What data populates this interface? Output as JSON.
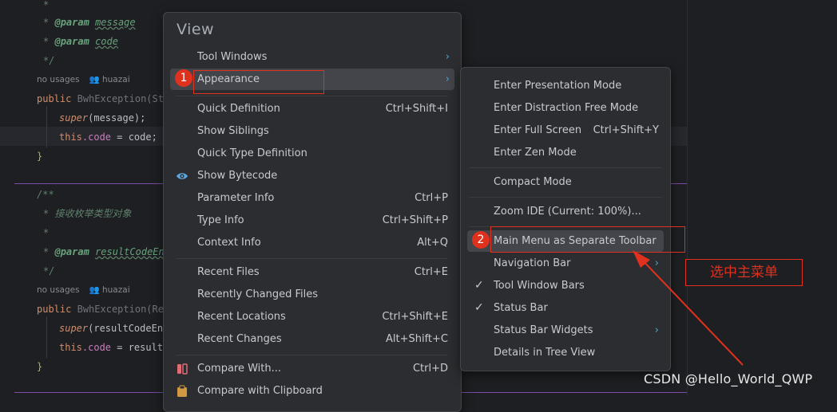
{
  "editor": {
    "doc1": {
      "star": "*",
      "param_tag": "@param",
      "param_message": "message",
      "param_code": "code",
      "end": "*/"
    },
    "hint1": {
      "usages": "no usages",
      "author": "huazai"
    },
    "ctor1": {
      "kw": "public",
      "name": "BwhException(Str",
      "super_kw": "super",
      "super_args": "(message);",
      "this_kw": "this",
      "field": ".code",
      "assign": " = code;",
      "close": "}"
    },
    "doc2": {
      "open": "/**",
      "desc": "* 接收枚举类型对象",
      "star": "*",
      "param_tag": "@param",
      "param_name": "resultCodeEnu",
      "end": "*/"
    },
    "hint2": {
      "usages": "no usages",
      "author": "huazai"
    },
    "ctor2": {
      "kw": "public",
      "name": "BwhException(Res",
      "super_kw": "super",
      "super_args": "(resultCodeEnu",
      "this_kw": "this",
      "field": ".code",
      "assign": " = resultC",
      "close": "}"
    }
  },
  "view_menu": {
    "title": "View",
    "items": [
      {
        "label": "Tool Windows",
        "submenu": true
      },
      {
        "label": "Appearance",
        "submenu": true,
        "selected": true
      },
      {
        "label": "Quick Definition",
        "shortcut": "Ctrl+Shift+I"
      },
      {
        "label": "Show Siblings"
      },
      {
        "label": "Quick Type Definition"
      },
      {
        "label": "Show Bytecode",
        "icon": "eye-icon"
      },
      {
        "label": "Parameter Info",
        "shortcut": "Ctrl+P"
      },
      {
        "label": "Type Info",
        "shortcut": "Ctrl+Shift+P"
      },
      {
        "label": "Context Info",
        "shortcut": "Alt+Q"
      },
      {
        "label": "Recent Files",
        "shortcut": "Ctrl+E"
      },
      {
        "label": "Recently Changed Files"
      },
      {
        "label": "Recent Locations",
        "shortcut": "Ctrl+Shift+E"
      },
      {
        "label": "Recent Changes",
        "shortcut": "Alt+Shift+C"
      },
      {
        "label": "Compare With...",
        "shortcut": "Ctrl+D",
        "icon": "compare-icon"
      },
      {
        "label": "Compare with Clipboard",
        "icon": "clipboard-compare-icon"
      }
    ]
  },
  "appearance_menu": {
    "items": [
      {
        "label": "Enter Presentation Mode"
      },
      {
        "label": "Enter Distraction Free Mode"
      },
      {
        "label": "Enter Full Screen",
        "shortcut": "Ctrl+Shift+Y"
      },
      {
        "label": "Enter Zen Mode"
      },
      {
        "label": "Compact Mode"
      },
      {
        "label": "Zoom IDE (Current: 100%)..."
      },
      {
        "label": "Main Menu as Separate Toolbar",
        "selected": true
      },
      {
        "label": "Navigation Bar",
        "submenu": true
      },
      {
        "label": "Tool Window Bars",
        "checked": true
      },
      {
        "label": "Status Bar",
        "checked": true
      },
      {
        "label": "Status Bar Widgets",
        "submenu": true
      },
      {
        "label": "Details in Tree View"
      }
    ]
  },
  "glyphs": {
    "arrow": "›",
    "check": "✓"
  },
  "annotations": {
    "badge1": "1",
    "badge2": "2",
    "note": "选中主菜单",
    "watermark": "CSDN @Hello_World_QWP"
  },
  "colors": {
    "accent_red": "#e0301e",
    "submenu_arrow": "#4aa3dd",
    "menu_bg": "#2b2d30",
    "editor_bg": "#1e1f22",
    "selection": "#43454a"
  }
}
